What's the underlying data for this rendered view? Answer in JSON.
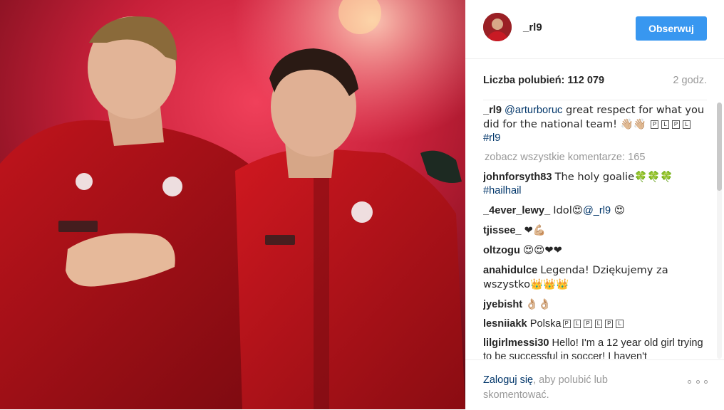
{
  "post": {
    "username": "_rl9",
    "follow_label": "Obserwuj",
    "likes_label": "Liczba polubień: 112 079",
    "time_ago": "2 godz."
  },
  "caption": {
    "user": "_rl9",
    "mention": "@arturboruc",
    "text": " great respect for what you did for the national team! 👋🏼👋🏼",
    "flags": [
      "P",
      "L",
      "P",
      "L"
    ],
    "hashtag": "#rl9"
  },
  "view_all_comments": "zobacz wszystkie komentarze: 165",
  "comments": [
    {
      "user": "johnforsyth83",
      "text": "The holy goalie🍀🍀🍀",
      "extra_link": "#hailhail"
    },
    {
      "user": "_4ever_lewy_",
      "text": "Idol😍",
      "mention": "@_rl9",
      "tail": " 😍"
    },
    {
      "user": "tjissee_",
      "text": "❤💪🏼"
    },
    {
      "user": "oltzogu",
      "text": "😍😍❤❤"
    },
    {
      "user": "anahidulce",
      "text": "Legenda! Dziękujemy za wszystko👑👑👑"
    },
    {
      "user": "jyebisht",
      "text": "👌🏼👌🏼"
    },
    {
      "user": "lesniiakk",
      "text": "Polska",
      "flags": [
        "P",
        "L",
        "P",
        "L",
        "P",
        "L"
      ]
    },
    {
      "user": "lilgirlmessi30",
      "text": "Hello! I'm a 12 year old girl trying to be successful in soccer! I haven't"
    }
  ],
  "footer": {
    "login_link": "Zaloguj się",
    "login_rest": ", aby polubić lub skomentować."
  },
  "colors": {
    "accent": "#3897f0",
    "link": "#003569",
    "muted": "#999999"
  },
  "icons": {
    "more": "more-options-icon"
  }
}
